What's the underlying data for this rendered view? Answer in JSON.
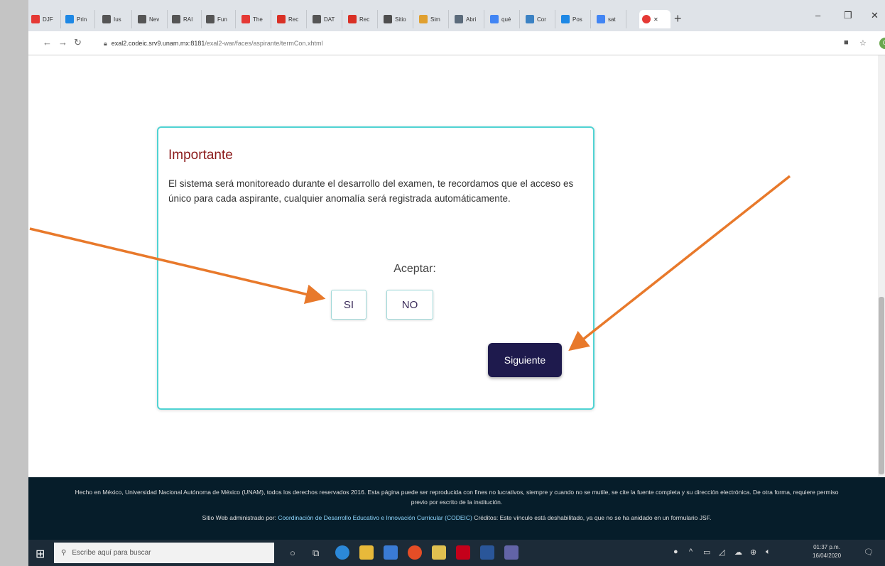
{
  "browser": {
    "tabs": [
      {
        "label": "DJF",
        "color": "#e53935"
      },
      {
        "label": "Prin",
        "color": "#1e88e5"
      },
      {
        "label": "Ius",
        "color": "#555555"
      },
      {
        "label": "Nev",
        "color": "#555555"
      },
      {
        "label": "RAI",
        "color": "#555555"
      },
      {
        "label": "Fun",
        "color": "#555555"
      },
      {
        "label": "The",
        "color": "#e53935"
      },
      {
        "label": "Rec",
        "color": "#d93025"
      },
      {
        "label": "DAT",
        "color": "#555555"
      },
      {
        "label": "Rec",
        "color": "#d93025"
      },
      {
        "label": "Sitio",
        "color": "#4e4e4e"
      },
      {
        "label": "Sim",
        "color": "#e0a030"
      },
      {
        "label": "Abri",
        "color": "#5b6b7b"
      },
      {
        "label": "qué",
        "color": "#4285f4"
      },
      {
        "label": "Cor",
        "color": "#3b82c4"
      },
      {
        "label": "Pos",
        "color": "#1e88e5"
      },
      {
        "label": "sat",
        "color": "#4285f4"
      }
    ],
    "url": "exal2.codeic.srv9.unam.mx:8181",
    "url_path": "/exal2-war/faces/aspirante/termCon.xhtml"
  },
  "card": {
    "title": "Importante",
    "text": "El sistema será monitoreado durante el desarrollo del examen, te recordamos que el acceso es único para cada aspirante, cualquier anomalía será registrada automáticamente.",
    "accept_label": "Aceptar:",
    "yes_label": "SI",
    "no_label": "NO",
    "next_label": "Siguiente"
  },
  "footer": {
    "line1": "Hecho en México, Universidad Nacional Autónoma de México (UNAM), todos los derechos reservados 2016. Esta página puede ser reproducida con fines no lucrativos, siempre y cuando no se mutile, se cite la fuente completa y su dirección electrónica. De otra forma, requiere permiso previo por escrito de la institución.",
    "admin_prefix": "Sitio Web administrado por:",
    "admin_link": "Coordinación de Desarrollo Educativo e Innovación Curricular (CODEIC)",
    "admin_suffix": "Créditos: Este vínculo está deshabilitado, ya que no se ha anidado en un formulario JSF."
  },
  "taskbar": {
    "search_placeholder": "Escribe aquí para buscar",
    "time": "01:37 p.m.",
    "date": "16/04/2020"
  },
  "colors": {
    "arrow": "#e8792b",
    "card_border": "#4fd3d3",
    "next_button": "#1e1a4d",
    "title": "#8b1a1a",
    "footer_bg": "#061d2a"
  }
}
